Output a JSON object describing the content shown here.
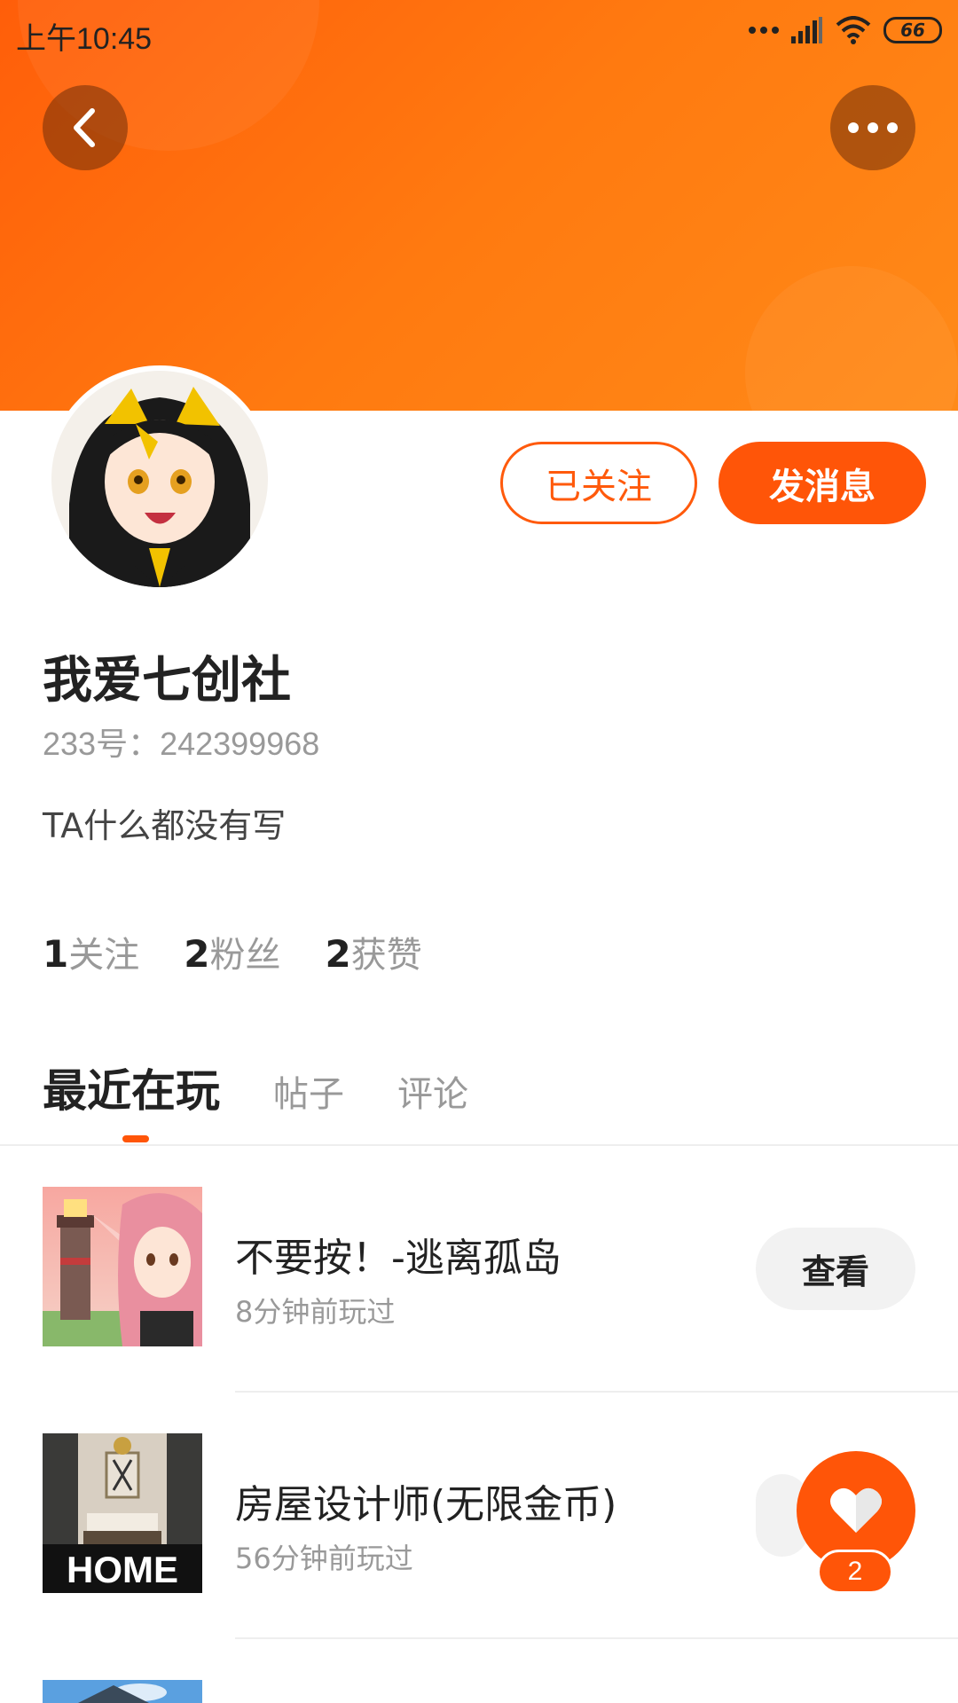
{
  "status_bar": {
    "time": "上午10:45",
    "battery": "66"
  },
  "header": {
    "accent_color": "#ff5a0c",
    "back_icon": "chevron-left-icon",
    "more_icon": "more-horizontal-icon"
  },
  "profile": {
    "follow_label": "已关注",
    "message_label": "发消息",
    "username": "我爱七创社",
    "user_id": "233号：242399968",
    "bio": "TA什么都没有写",
    "stats": [
      {
        "num": "1",
        "label": "关注"
      },
      {
        "num": "2",
        "label": "粉丝"
      },
      {
        "num": "2",
        "label": "获赞"
      }
    ]
  },
  "tabs": [
    {
      "label": "最近在玩",
      "active": true
    },
    {
      "label": "帖子",
      "active": false
    },
    {
      "label": "评论",
      "active": false
    }
  ],
  "games": [
    {
      "title": "不要按！-逃离孤岛",
      "time": "8分钟前玩过",
      "action": "查看"
    },
    {
      "title": "房屋设计师(无限金币)",
      "time": "56分钟前玩过",
      "thumb_text": "HOME"
    }
  ],
  "like": {
    "icon": "heart-icon",
    "count": "2"
  }
}
